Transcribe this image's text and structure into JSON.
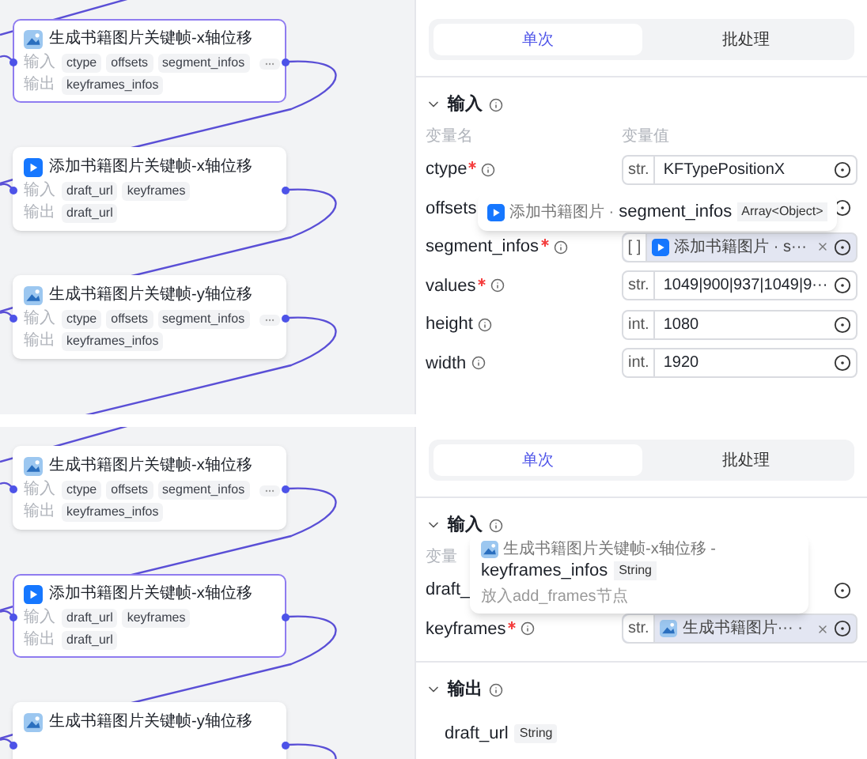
{
  "panels": [
    {
      "canvas": {
        "nodes": [
          {
            "kind": "generator",
            "title": "生成书籍图片关键帧-x轴位移",
            "selected": true,
            "input_label": "输入",
            "inputs": [
              "ctype",
              "offsets",
              "segment_infos"
            ],
            "more_inputs": true,
            "output_label": "输出",
            "outputs": [
              "keyframes_infos"
            ]
          },
          {
            "kind": "plugin",
            "title": "添加书籍图片关键帧-x轴位移",
            "selected": false,
            "input_label": "输入",
            "inputs": [
              "draft_url",
              "keyframes"
            ],
            "more_inputs": false,
            "output_label": "输出",
            "outputs": [
              "draft_url"
            ]
          },
          {
            "kind": "generator",
            "title": "生成书籍图片关键帧-y轴位移",
            "selected": false,
            "input_label": "输入",
            "inputs": [
              "ctype",
              "offsets",
              "segment_infos"
            ],
            "more_inputs": true,
            "output_label": "输出",
            "outputs": [
              "keyframes_infos"
            ]
          }
        ]
      },
      "inspector": {
        "tabs": [
          {
            "label": "单次",
            "selected": true
          },
          {
            "label": "批处理",
            "selected": false
          }
        ],
        "sections": [
          {
            "title": "输入",
            "expanded": true,
            "headers": [
              "变量名",
              "变量值"
            ],
            "rows": [
              {
                "name": "ctype",
                "required": true,
                "kind": "text",
                "type": "str.",
                "value": "KFTypePositionX"
              },
              {
                "name": "offsets",
                "required": false,
                "kind": "covered"
              },
              {
                "name": "segment_infos",
                "required": true,
                "kind": "reference",
                "type": "[ ]",
                "reference": {
                  "kind": "plugin",
                  "label": "添加书籍图片 · s···"
                }
              },
              {
                "name": "values",
                "required": true,
                "kind": "text",
                "type": "str.",
                "value": "1049|900|937|1049|9···"
              },
              {
                "name": "height",
                "required": false,
                "kind": "text",
                "type": "int.",
                "value": "1080"
              },
              {
                "name": "width",
                "required": false,
                "kind": "text",
                "type": "int.",
                "value": "1920"
              }
            ]
          }
        ],
        "tooltip": {
          "kind": "inline",
          "source": {
            "kind": "plugin",
            "title": "添加书籍图片 ·"
          },
          "name": "segment_infos",
          "type": "Array<Object>"
        }
      }
    },
    {
      "canvas": {
        "nodes": [
          {
            "kind": "generator",
            "title": "生成书籍图片关键帧-x轴位移",
            "selected": false,
            "input_label": "输入",
            "inputs": [
              "ctype",
              "offsets",
              "segment_infos"
            ],
            "more_inputs": true,
            "output_label": "输出",
            "outputs": [
              "keyframes_infos"
            ]
          },
          {
            "kind": "plugin",
            "title": "添加书籍图片关键帧-x轴位移",
            "selected": true,
            "input_label": "输入",
            "inputs": [
              "draft_url",
              "keyframes"
            ],
            "more_inputs": false,
            "output_label": "输出",
            "outputs": [
              "draft_url"
            ]
          },
          {
            "kind": "generator",
            "title": "生成书籍图片关键帧-y轴位移",
            "selected": false
          }
        ]
      },
      "inspector": {
        "tabs": [
          {
            "label": "单次",
            "selected": true
          },
          {
            "label": "批处理",
            "selected": false
          }
        ],
        "sections": [
          {
            "title": "输入",
            "expanded": true,
            "headers": [
              "变量"
            ],
            "rows": [
              {
                "name": "draft_",
                "required": false,
                "kind": "covered"
              },
              {
                "name": "keyframes",
                "required": true,
                "kind": "reference",
                "type": "str.",
                "reference": {
                  "kind": "generator",
                  "label": "生成书籍图片··· ·"
                }
              }
            ]
          },
          {
            "title": "输出",
            "expanded": true,
            "rows": [
              {
                "name": "draft_url",
                "required": false,
                "kind": "output",
                "type": "String"
              }
            ]
          }
        ],
        "tooltip": {
          "kind": "stacked",
          "source": {
            "kind": "generator",
            "title": "生成书籍图片关键帧-x轴位移 -"
          },
          "name": "keyframes_infos",
          "type": "String",
          "description": "放入add_frames节点"
        }
      }
    }
  ]
}
